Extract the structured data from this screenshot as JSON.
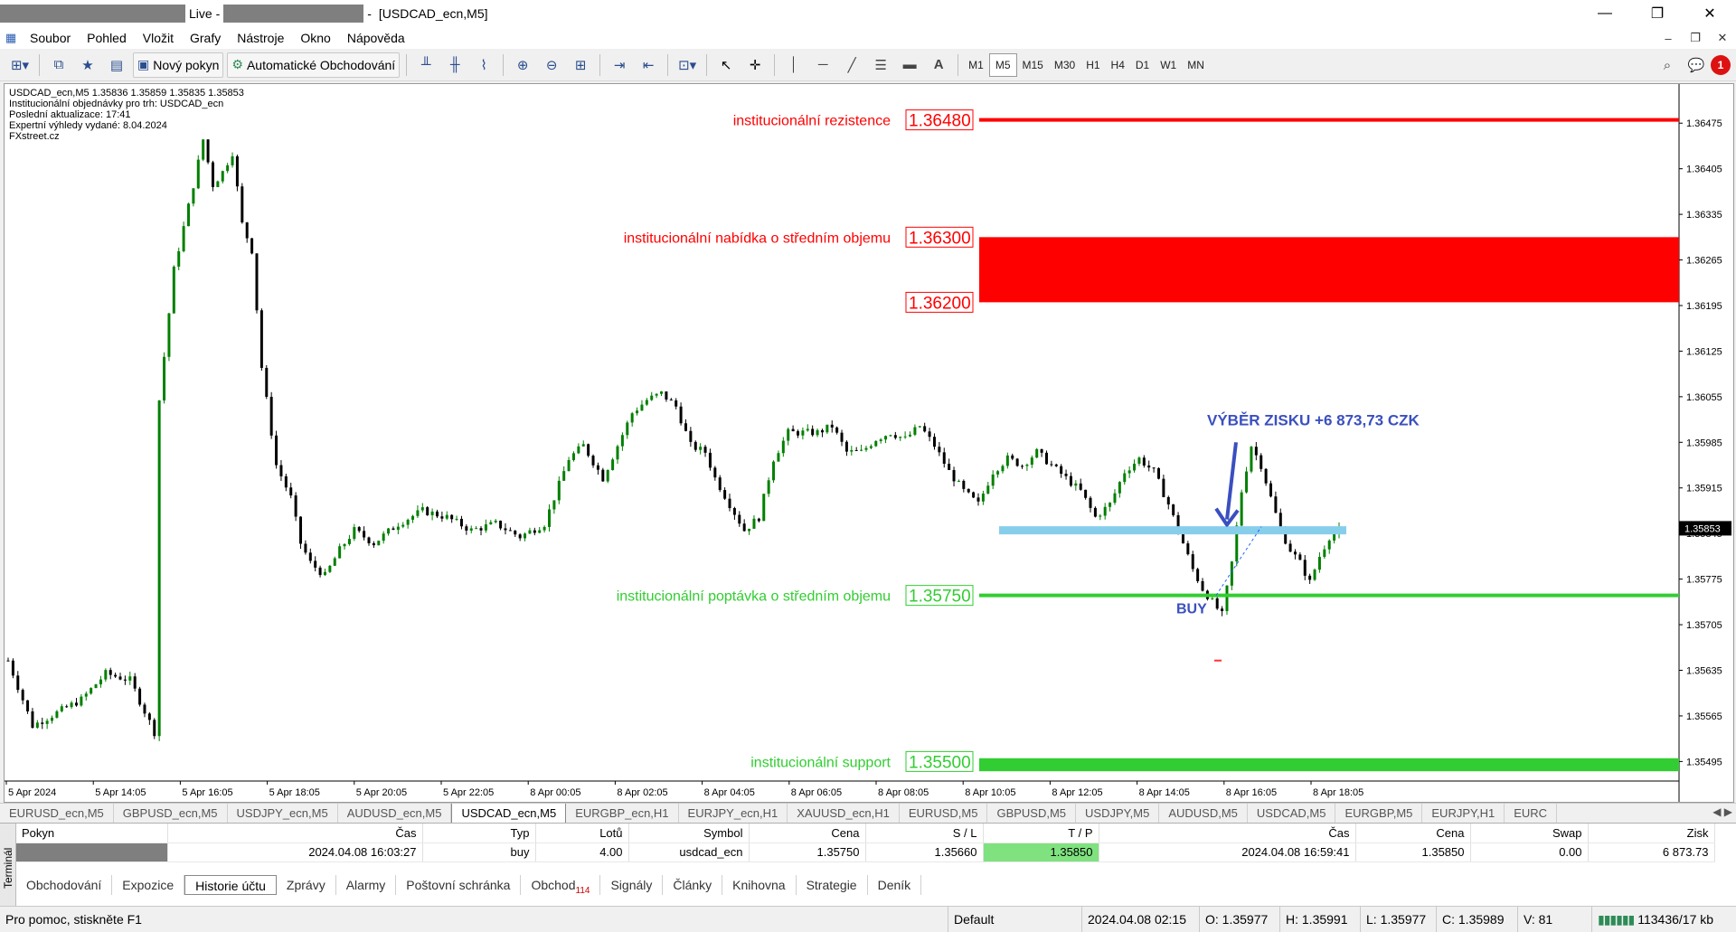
{
  "window": {
    "title_live": "Live -",
    "title_dash": "-",
    "title_symbol": "[USDCAD_ecn,M5]",
    "minimize": "—",
    "restore": "❐",
    "close": "✕"
  },
  "menu": {
    "items": [
      "Soubor",
      "Pohled",
      "Vložit",
      "Grafy",
      "Nástroje",
      "Okno",
      "Nápověda"
    ],
    "right": [
      "–",
      "❐",
      "✕"
    ]
  },
  "toolbar": {
    "new_order": "Nový pokyn",
    "auto_trading": "Automatické Obchodování",
    "text_tool": "A",
    "timeframes": [
      "M1",
      "M5",
      "M15",
      "M30",
      "H1",
      "H4",
      "D1",
      "W1",
      "MN"
    ],
    "active_timeframe": "M5",
    "notification_count": "1"
  },
  "chart": {
    "info_lines": [
      "USDCAD_ecn,M5  1.35836 1.35859 1.35835 1.35853",
      "Institucionální objednávky pro trh: USDCAD_ecn",
      "Poslední aktualizace: 17:41",
      "Expertní výhledy vydané: 8.04.2024",
      "FXstreet.cz"
    ],
    "current_price": "1.35853",
    "annotations": {
      "profit": "VÝBĚR ZISKU +6 873,73 CZK",
      "buy": "BUY",
      "resistance": "institucionální rezistence",
      "supply": "institucionální nabídka o středním objemu",
      "demand": "institucionální poptávka o středním objemu",
      "support": "institucionální support"
    },
    "level_labels": {
      "resistance": "1.36480",
      "supply_top": "1.36300",
      "supply_bottom": "1.36200",
      "demand": "1.35750",
      "support": "1.35500"
    },
    "colors": {
      "red": "#ff0000",
      "green": "#32cd32",
      "take_profit": "#87ceeb",
      "annotation_blue": "#3a4fbf",
      "bull": "#008000",
      "bear": "#000000"
    }
  },
  "chart_data": {
    "type": "candlestick",
    "y_ticks": [
      "1.36475",
      "1.36405",
      "1.36335",
      "1.36265",
      "1.36195",
      "1.36125",
      "1.36055",
      "1.35985",
      "1.35915",
      "1.35845",
      "1.35775",
      "1.35705",
      "1.35635",
      "1.35565",
      "1.35495"
    ],
    "x_ticks": [
      "5 Apr 2024",
      "5 Apr 14:05",
      "5 Apr 16:05",
      "5 Apr 18:05",
      "5 Apr 20:05",
      "5 Apr 22:05",
      "8 Apr 00:05",
      "8 Apr 02:05",
      "8 Apr 04:05",
      "8 Apr 06:05",
      "8 Apr 08:05",
      "8 Apr 10:05",
      "8 Apr 12:05",
      "8 Apr 14:05",
      "8 Apr 16:05",
      "8 Apr 18:05"
    ],
    "ylim": [
      1.35465,
      1.36535
    ],
    "levels": {
      "resistance": 1.3648,
      "supply_zone": [
        1.362,
        1.363
      ],
      "take_profit": 1.3585,
      "demand": 1.3575,
      "support_zone": [
        1.3548,
        1.355
      ],
      "entry": 1.3575
    },
    "price_path": [
      [
        0,
        1.3565
      ],
      [
        5,
        1.3555
      ],
      [
        10,
        1.3557
      ],
      [
        15,
        1.3559
      ],
      [
        20,
        1.3563
      ],
      [
        25,
        1.3562
      ],
      [
        30,
        1.3554
      ],
      [
        31,
        1.3605
      ],
      [
        34,
        1.3625
      ],
      [
        38,
        1.3638
      ],
      [
        40,
        1.3645
      ],
      [
        42,
        1.3638
      ],
      [
        44,
        1.364
      ],
      [
        46,
        1.3643
      ],
      [
        48,
        1.3632
      ],
      [
        50,
        1.3628
      ],
      [
        52,
        1.361
      ],
      [
        55,
        1.3595
      ],
      [
        58,
        1.359
      ],
      [
        60,
        1.3583
      ],
      [
        62,
        1.358
      ],
      [
        65,
        1.3578
      ],
      [
        68,
        1.3582
      ],
      [
        71,
        1.3585
      ],
      [
        75,
        1.3583
      ],
      [
        80,
        1.3586
      ],
      [
        85,
        1.3588
      ],
      [
        90,
        1.3587
      ],
      [
        95,
        1.3585
      ],
      [
        100,
        1.3586
      ],
      [
        105,
        1.3584
      ],
      [
        110,
        1.3586
      ],
      [
        115,
        1.3596
      ],
      [
        118,
        1.3598
      ],
      [
        122,
        1.3593
      ],
      [
        125,
        1.3598
      ],
      [
        128,
        1.3603
      ],
      [
        131,
        1.3605
      ],
      [
        134,
        1.3606
      ],
      [
        137,
        1.3604
      ],
      [
        140,
        1.3598
      ],
      [
        143,
        1.3597
      ],
      [
        145,
        1.3593
      ],
      [
        148,
        1.3589
      ],
      [
        151,
        1.3585
      ],
      [
        154,
        1.3587
      ],
      [
        157,
        1.3596
      ],
      [
        160,
        1.36
      ],
      [
        163,
        1.36
      ],
      [
        166,
        1.36
      ],
      [
        169,
        1.3601
      ],
      [
        172,
        1.3597
      ],
      [
        175,
        1.3597
      ],
      [
        178,
        1.3599
      ],
      [
        181,
        1.36
      ],
      [
        184,
        1.3599
      ],
      [
        187,
        1.3601
      ],
      [
        190,
        1.3598
      ],
      [
        193,
        1.3594
      ],
      [
        196,
        1.3591
      ],
      [
        199,
        1.3589
      ],
      [
        202,
        1.3594
      ],
      [
        205,
        1.3596
      ],
      [
        208,
        1.3595
      ],
      [
        211,
        1.3597
      ],
      [
        214,
        1.3595
      ],
      [
        217,
        1.3593
      ],
      [
        220,
        1.3591
      ],
      [
        223,
        1.3587
      ],
      [
        226,
        1.3589
      ],
      [
        229,
        1.3594
      ],
      [
        232,
        1.3596
      ],
      [
        235,
        1.3594
      ],
      [
        238,
        1.3589
      ],
      [
        241,
        1.3583
      ],
      [
        243,
        1.3579
      ],
      [
        245,
        1.3576
      ],
      [
        247,
        1.3574
      ],
      [
        249,
        1.3572
      ],
      [
        251,
        1.358
      ],
      [
        253,
        1.3591
      ],
      [
        255,
        1.3598
      ],
      [
        257,
        1.3595
      ],
      [
        259,
        1.359
      ],
      [
        261,
        1.3585
      ],
      [
        263,
        1.3582
      ],
      [
        265,
        1.358
      ],
      [
        267,
        1.3577
      ],
      [
        269,
        1.3581
      ],
      [
        271,
        1.3584
      ],
      [
        273,
        1.3585
      ]
    ]
  },
  "symbol_tabs": [
    "EURUSD_ecn,M5",
    "GBPUSD_ecn,M5",
    "USDJPY_ecn,M5",
    "AUDUSD_ecn,M5",
    "USDCAD_ecn,M5",
    "EURGBP_ecn,H1",
    "EURJPY_ecn,H1",
    "XAUUSD_ecn,H1",
    "EURUSD,M5",
    "GBPUSD,M5",
    "USDJPY,M5",
    "AUDUSD,M5",
    "USDCAD,M5",
    "EURGBP,M5",
    "EURJPY,H1",
    "EURC"
  ],
  "active_symbol_tab": "USDCAD_ecn,M5",
  "terminal": {
    "side_label": "Terminál",
    "headers": {
      "order": "Pokyn",
      "time": "Čas",
      "type": "Typ",
      "lots": "Lotů",
      "symbol": "Symbol",
      "price": "Cena",
      "sl": "S / L",
      "tp": "T / P",
      "close_time": "Čas",
      "close_price": "Cena",
      "swap": "Swap",
      "profit": "Zisk"
    },
    "row": {
      "time": "2024.04.08 16:03:27",
      "type": "buy",
      "lots": "4.00",
      "symbol": "usdcad_ecn",
      "price": "1.35750",
      "sl": "1.35660",
      "tp": "1.35850",
      "close_time": "2024.04.08 16:59:41",
      "close_price": "1.35850",
      "swap": "0.00",
      "profit": "6 873.73"
    },
    "tabs": [
      "Obchodování",
      "Expozice",
      "Historie účtu",
      "Zprávy",
      "Alarmy",
      "Poštovní schránka",
      "Obchod",
      "Signály",
      "Články",
      "Knihovna",
      "Strategie",
      "Deník"
    ],
    "active_tab": "Historie účtu",
    "trade_badge": "114"
  },
  "status": {
    "help": "Pro pomoc, stiskněte F1",
    "profile": "Default",
    "datetime": "2024.04.08 02:15",
    "open": "O: 1.35977",
    "high": "H: 1.35991",
    "low": "L: 1.35977",
    "close": "C: 1.35989",
    "volume": "V: 81",
    "traffic": "113436/17 kb"
  }
}
